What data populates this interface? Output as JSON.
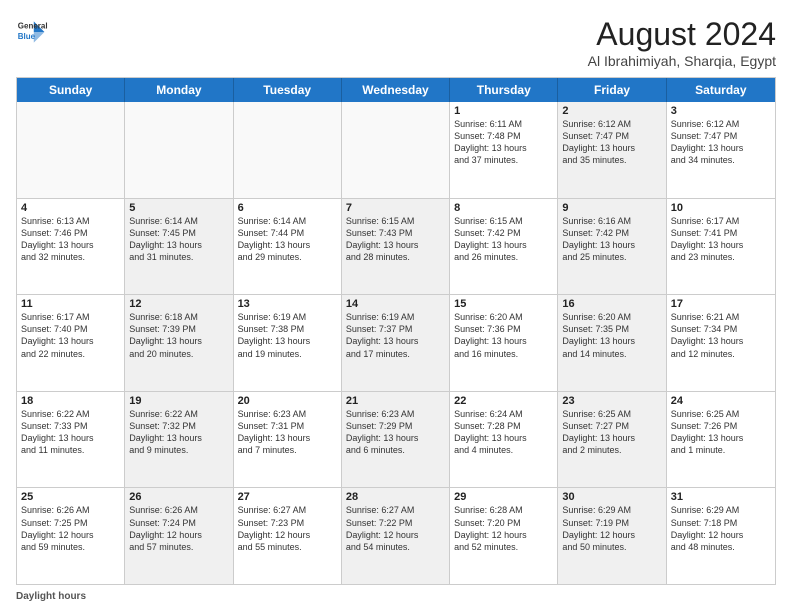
{
  "header": {
    "logo_line1": "General",
    "logo_line2": "Blue",
    "title": "August 2024",
    "subtitle": "Al Ibrahimiyah, Sharqia, Egypt"
  },
  "footer": {
    "label": "Daylight hours"
  },
  "days_of_week": [
    "Sunday",
    "Monday",
    "Tuesday",
    "Wednesday",
    "Thursday",
    "Friday",
    "Saturday"
  ],
  "weeks": [
    [
      {
        "day": "",
        "text": "",
        "empty": true
      },
      {
        "day": "",
        "text": "",
        "empty": true
      },
      {
        "day": "",
        "text": "",
        "empty": true
      },
      {
        "day": "",
        "text": "",
        "empty": true
      },
      {
        "day": "1",
        "text": "Sunrise: 6:11 AM\nSunset: 7:48 PM\nDaylight: 13 hours\nand 37 minutes.",
        "shaded": false
      },
      {
        "day": "2",
        "text": "Sunrise: 6:12 AM\nSunset: 7:47 PM\nDaylight: 13 hours\nand 35 minutes.",
        "shaded": true
      },
      {
        "day": "3",
        "text": "Sunrise: 6:12 AM\nSunset: 7:47 PM\nDaylight: 13 hours\nand 34 minutes.",
        "shaded": false
      }
    ],
    [
      {
        "day": "4",
        "text": "Sunrise: 6:13 AM\nSunset: 7:46 PM\nDaylight: 13 hours\nand 32 minutes.",
        "shaded": false
      },
      {
        "day": "5",
        "text": "Sunrise: 6:14 AM\nSunset: 7:45 PM\nDaylight: 13 hours\nand 31 minutes.",
        "shaded": true
      },
      {
        "day": "6",
        "text": "Sunrise: 6:14 AM\nSunset: 7:44 PM\nDaylight: 13 hours\nand 29 minutes.",
        "shaded": false
      },
      {
        "day": "7",
        "text": "Sunrise: 6:15 AM\nSunset: 7:43 PM\nDaylight: 13 hours\nand 28 minutes.",
        "shaded": true
      },
      {
        "day": "8",
        "text": "Sunrise: 6:15 AM\nSunset: 7:42 PM\nDaylight: 13 hours\nand 26 minutes.",
        "shaded": false
      },
      {
        "day": "9",
        "text": "Sunrise: 6:16 AM\nSunset: 7:42 PM\nDaylight: 13 hours\nand 25 minutes.",
        "shaded": true
      },
      {
        "day": "10",
        "text": "Sunrise: 6:17 AM\nSunset: 7:41 PM\nDaylight: 13 hours\nand 23 minutes.",
        "shaded": false
      }
    ],
    [
      {
        "day": "11",
        "text": "Sunrise: 6:17 AM\nSunset: 7:40 PM\nDaylight: 13 hours\nand 22 minutes.",
        "shaded": false
      },
      {
        "day": "12",
        "text": "Sunrise: 6:18 AM\nSunset: 7:39 PM\nDaylight: 13 hours\nand 20 minutes.",
        "shaded": true
      },
      {
        "day": "13",
        "text": "Sunrise: 6:19 AM\nSunset: 7:38 PM\nDaylight: 13 hours\nand 19 minutes.",
        "shaded": false
      },
      {
        "day": "14",
        "text": "Sunrise: 6:19 AM\nSunset: 7:37 PM\nDaylight: 13 hours\nand 17 minutes.",
        "shaded": true
      },
      {
        "day": "15",
        "text": "Sunrise: 6:20 AM\nSunset: 7:36 PM\nDaylight: 13 hours\nand 16 minutes.",
        "shaded": false
      },
      {
        "day": "16",
        "text": "Sunrise: 6:20 AM\nSunset: 7:35 PM\nDaylight: 13 hours\nand 14 minutes.",
        "shaded": true
      },
      {
        "day": "17",
        "text": "Sunrise: 6:21 AM\nSunset: 7:34 PM\nDaylight: 13 hours\nand 12 minutes.",
        "shaded": false
      }
    ],
    [
      {
        "day": "18",
        "text": "Sunrise: 6:22 AM\nSunset: 7:33 PM\nDaylight: 13 hours\nand 11 minutes.",
        "shaded": false
      },
      {
        "day": "19",
        "text": "Sunrise: 6:22 AM\nSunset: 7:32 PM\nDaylight: 13 hours\nand 9 minutes.",
        "shaded": true
      },
      {
        "day": "20",
        "text": "Sunrise: 6:23 AM\nSunset: 7:31 PM\nDaylight: 13 hours\nand 7 minutes.",
        "shaded": false
      },
      {
        "day": "21",
        "text": "Sunrise: 6:23 AM\nSunset: 7:29 PM\nDaylight: 13 hours\nand 6 minutes.",
        "shaded": true
      },
      {
        "day": "22",
        "text": "Sunrise: 6:24 AM\nSunset: 7:28 PM\nDaylight: 13 hours\nand 4 minutes.",
        "shaded": false
      },
      {
        "day": "23",
        "text": "Sunrise: 6:25 AM\nSunset: 7:27 PM\nDaylight: 13 hours\nand 2 minutes.",
        "shaded": true
      },
      {
        "day": "24",
        "text": "Sunrise: 6:25 AM\nSunset: 7:26 PM\nDaylight: 13 hours\nand 1 minute.",
        "shaded": false
      }
    ],
    [
      {
        "day": "25",
        "text": "Sunrise: 6:26 AM\nSunset: 7:25 PM\nDaylight: 12 hours\nand 59 minutes.",
        "shaded": false
      },
      {
        "day": "26",
        "text": "Sunrise: 6:26 AM\nSunset: 7:24 PM\nDaylight: 12 hours\nand 57 minutes.",
        "shaded": true
      },
      {
        "day": "27",
        "text": "Sunrise: 6:27 AM\nSunset: 7:23 PM\nDaylight: 12 hours\nand 55 minutes.",
        "shaded": false
      },
      {
        "day": "28",
        "text": "Sunrise: 6:27 AM\nSunset: 7:22 PM\nDaylight: 12 hours\nand 54 minutes.",
        "shaded": true
      },
      {
        "day": "29",
        "text": "Sunrise: 6:28 AM\nSunset: 7:20 PM\nDaylight: 12 hours\nand 52 minutes.",
        "shaded": false
      },
      {
        "day": "30",
        "text": "Sunrise: 6:29 AM\nSunset: 7:19 PM\nDaylight: 12 hours\nand 50 minutes.",
        "shaded": true
      },
      {
        "day": "31",
        "text": "Sunrise: 6:29 AM\nSunset: 7:18 PM\nDaylight: 12 hours\nand 48 minutes.",
        "shaded": false
      }
    ]
  ]
}
